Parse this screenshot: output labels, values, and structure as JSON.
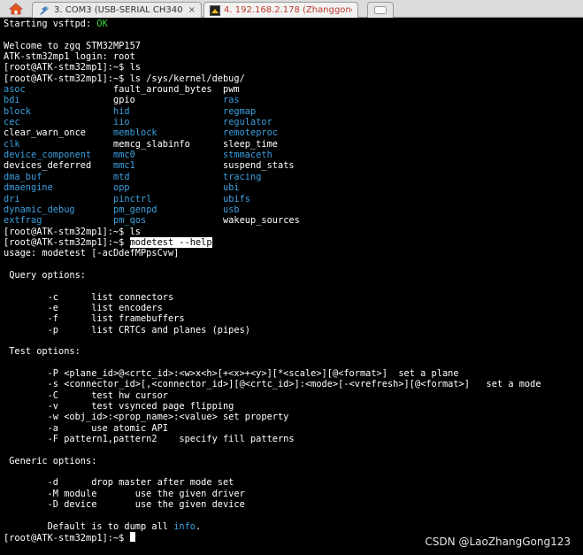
{
  "tabs": [
    {
      "label": "3. COM3  (USB-SERIAL CH340 (CO",
      "close": "×"
    },
    {
      "label": "4. 192.168.2.178 (Zhanggong)",
      "close": ""
    }
  ],
  "prompt": "[root@ATK-stm32mp1]:~$",
  "terminal": {
    "starting": "Starting vsftpd: ",
    "ok": "OK",
    "welcome": "Welcome to zgq STM32MP157",
    "login": "ATK-stm32mp1 login: root",
    "cmd_ls": " ls",
    "cmd_ls_debug": " ls /sys/kernel/debug/",
    "debug_entries": [
      [
        {
          "t": "asoc",
          "dir": true
        },
        {
          "t": "fault_around_bytes",
          "dir": false
        },
        {
          "t": "pwm",
          "dir": false
        }
      ],
      [
        {
          "t": "bdi",
          "dir": true
        },
        {
          "t": "gpio",
          "dir": false
        },
        {
          "t": "ras",
          "dir": true
        }
      ],
      [
        {
          "t": "block",
          "dir": true
        },
        {
          "t": "hid",
          "dir": true
        },
        {
          "t": "regmap",
          "dir": true
        }
      ],
      [
        {
          "t": "cec",
          "dir": true
        },
        {
          "t": "iio",
          "dir": true
        },
        {
          "t": "regulator",
          "dir": true
        }
      ],
      [
        {
          "t": "clear_warn_once",
          "dir": false
        },
        {
          "t": "memblock",
          "dir": true
        },
        {
          "t": "remoteproc",
          "dir": true
        }
      ],
      [
        {
          "t": "clk",
          "dir": true
        },
        {
          "t": "memcg_slabinfo",
          "dir": false
        },
        {
          "t": "sleep_time",
          "dir": false
        }
      ],
      [
        {
          "t": "device_component",
          "dir": true
        },
        {
          "t": "mmc0",
          "dir": true
        },
        {
          "t": "stmmaceth",
          "dir": true
        }
      ],
      [
        {
          "t": "devices_deferred",
          "dir": false
        },
        {
          "t": "mmc1",
          "dir": true
        },
        {
          "t": "suspend_stats",
          "dir": false
        }
      ],
      [
        {
          "t": "dma_buf",
          "dir": true
        },
        {
          "t": "mtd",
          "dir": true
        },
        {
          "t": "tracing",
          "dir": true
        }
      ],
      [
        {
          "t": "dmaengine",
          "dir": true
        },
        {
          "t": "opp",
          "dir": true
        },
        {
          "t": "ubi",
          "dir": true
        }
      ],
      [
        {
          "t": "dri",
          "dir": true
        },
        {
          "t": "pinctrl",
          "dir": true
        },
        {
          "t": "ubifs",
          "dir": true
        }
      ],
      [
        {
          "t": "dynamic_debug",
          "dir": true
        },
        {
          "t": "pm_genpd",
          "dir": true
        },
        {
          "t": "usb",
          "dir": true
        }
      ],
      [
        {
          "t": "extfrag",
          "dir": true
        },
        {
          "t": "pm_qos",
          "dir": true
        },
        {
          "t": "wakeup_sources",
          "dir": false
        }
      ]
    ],
    "cmd_modetest": "modetest --help",
    "usage": "usage: modetest [-acDdefMPpsCvw]",
    "query_header": " Query options:",
    "query_opts": [
      "        -c      list connectors",
      "        -e      list encoders",
      "        -f      list framebuffers",
      "        -p      list CRTCs and planes (pipes)"
    ],
    "test_header": " Test options:",
    "test_opts": [
      "        -P <plane_id>@<crtc_id>:<w>x<h>[+<x>+<y>][*<scale>][@<format>]  set a plane",
      "        -s <connector_id>[,<connector_id>][@<crtc_id>]:<mode>[-<vrefresh>][@<format>]   set a mode",
      "        -C      test hw cursor",
      "        -v      test vsynced page flipping",
      "        -w <obj_id>:<prop_name>:<value> set property",
      "        -a      use atomic API",
      "        -F pattern1,pattern2    specify fill patterns"
    ],
    "generic_header": " Generic options:",
    "generic_opts": [
      "        -d      drop master after mode set",
      "        -M module       use the given driver",
      "        -D device       use the given device"
    ],
    "default_prefix": "        Default is to dump all ",
    "default_word": "info",
    "default_suffix": "."
  },
  "watermark": "CSDN @LaoZhangGong123",
  "colors": {
    "dir": "#3aa0e0",
    "ok": "#3bd33b",
    "bg": "#000000",
    "fg": "#ffffff"
  },
  "icons": [
    "home-icon",
    "serial-icon",
    "ssh-icon",
    "new-tab-icon"
  ]
}
